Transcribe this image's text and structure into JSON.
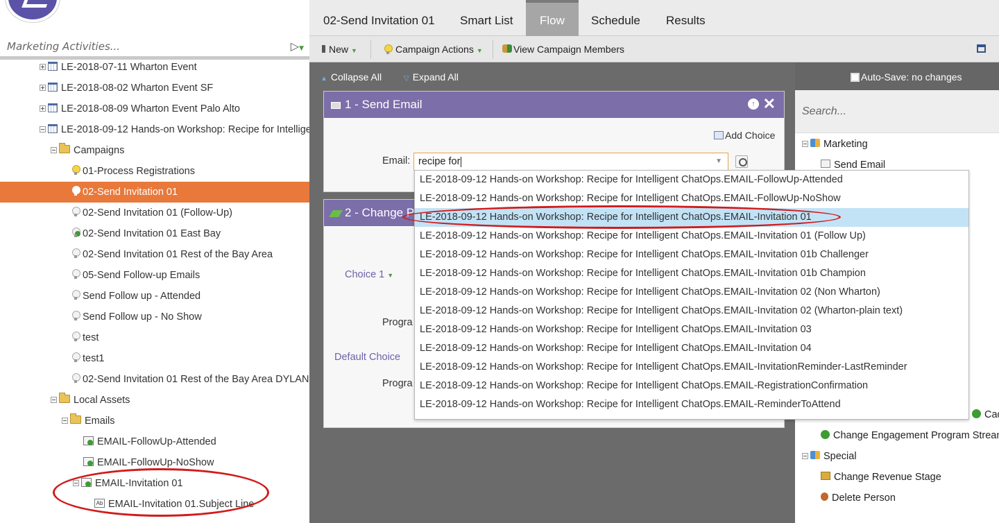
{
  "left_panel": {
    "search_placeholder": "Marketing Activities...",
    "tree": [
      {
        "label": "LE-2018-07-11 Wharton Event",
        "icon": "calendar-icon",
        "indent": 1,
        "toggle": "plus"
      },
      {
        "label": "LE-2018-08-02 Wharton Event SF",
        "icon": "calendar-icon",
        "indent": 1,
        "toggle": "plus"
      },
      {
        "label": "LE-2018-08-09 Wharton Event Palo Alto",
        "icon": "calendar-icon",
        "indent": 1,
        "toggle": "plus"
      },
      {
        "label": "LE-2018-09-12 Hands-on Workshop: Recipe for Intellige",
        "icon": "calendar-icon",
        "indent": 1,
        "toggle": "minus"
      },
      {
        "label": "Campaigns",
        "icon": "folder-icon",
        "indent": 2,
        "toggle": "minus"
      },
      {
        "label": "01-Process Registrations",
        "icon": "bulb-on-icon",
        "indent": 3
      },
      {
        "label": "02-Send Invitation 01",
        "icon": "bulb-icon",
        "indent": 3,
        "selected": true
      },
      {
        "label": "02-Send Invitation 01 (Follow-Up)",
        "icon": "bulb-icon",
        "indent": 3
      },
      {
        "label": "02-Send Invitation 01 East Bay",
        "icon": "bulb-check-icon",
        "indent": 3
      },
      {
        "label": "02-Send Invitation 01 Rest of the Bay Area",
        "icon": "bulb-icon",
        "indent": 3
      },
      {
        "label": "05-Send Follow-up Emails",
        "icon": "bulb-icon",
        "indent": 3
      },
      {
        "label": "Send Follow up - Attended",
        "icon": "bulb-icon",
        "indent": 3
      },
      {
        "label": "Send Follow up - No Show",
        "icon": "bulb-icon",
        "indent": 3
      },
      {
        "label": "test",
        "icon": "bulb-icon",
        "indent": 3
      },
      {
        "label": "test1",
        "icon": "bulb-icon",
        "indent": 3
      },
      {
        "label": "02-Send Invitation 01 Rest of the Bay Area DYLAN",
        "icon": "bulb-icon",
        "indent": 3
      },
      {
        "label": "Local Assets",
        "icon": "folder-icon",
        "indent": 2,
        "toggle": "minus"
      },
      {
        "label": "Emails",
        "icon": "folder-icon",
        "indent": 3,
        "toggle": "minus"
      },
      {
        "label": "EMAIL-FollowUp-Attended",
        "icon": "email-approved-icon",
        "indent": 4
      },
      {
        "label": "EMAIL-FollowUp-NoShow",
        "icon": "email-approved-icon",
        "indent": 4
      },
      {
        "label": "EMAIL-Invitation 01",
        "icon": "email-approved-icon",
        "indent": 4,
        "toggle": "minus"
      },
      {
        "label": "EMAIL-Invitation 01.Subject Line",
        "icon": "subject-line-icon",
        "indent": 5
      }
    ]
  },
  "tabs": [
    "02-Send Invitation 01",
    "Smart List",
    "Flow",
    "Schedule",
    "Results"
  ],
  "active_tab": "Flow",
  "toolbar": {
    "new_label": "New",
    "campaign_actions_label": "Campaign Actions",
    "view_members_label": "View Campaign Members"
  },
  "canvas_bar": {
    "collapse_all": "Collapse All",
    "expand_all": "Expand All",
    "autosave": "Auto-Save: no changes"
  },
  "step1": {
    "title": "1 - Send Email",
    "add_choice": "Add Choice",
    "email_label": "Email:",
    "email_value": "recipe for"
  },
  "step2": {
    "title": "2 - Change P",
    "choice1": "Choice 1",
    "program_label": "Progra",
    "default_choice": "Default Choice",
    "program_label2": "Progra"
  },
  "dropdown": {
    "highlighted_index": 2,
    "items": [
      "LE-2018-09-12 Hands-on Workshop: Recipe for Intelligent ChatOps.EMAIL-FollowUp-Attended",
      "LE-2018-09-12 Hands-on Workshop: Recipe for Intelligent ChatOps.EMAIL-FollowUp-NoShow",
      "LE-2018-09-12 Hands-on Workshop: Recipe for Intelligent ChatOps.EMAIL-Invitation 01",
      "LE-2018-09-12 Hands-on Workshop: Recipe for Intelligent ChatOps.EMAIL-Invitation 01 (Follow Up)",
      "LE-2018-09-12 Hands-on Workshop: Recipe for Intelligent ChatOps.EMAIL-Invitation 01b Challenger",
      "LE-2018-09-12 Hands-on Workshop: Recipe for Intelligent ChatOps.EMAIL-Invitation 01b Champion",
      "LE-2018-09-12 Hands-on Workshop: Recipe for Intelligent ChatOps.EMAIL-Invitation 02 (Non Wharton)",
      "LE-2018-09-12 Hands-on Workshop: Recipe for Intelligent ChatOps.EMAIL-Invitation 02 (Wharton-plain text)",
      "LE-2018-09-12 Hands-on Workshop: Recipe for Intelligent ChatOps.EMAIL-Invitation 03",
      "LE-2018-09-12 Hands-on Workshop: Recipe for Intelligent ChatOps.EMAIL-Invitation 04",
      "LE-2018-09-12 Hands-on Workshop: Recipe for Intelligent ChatOps.EMAIL-InvitationReminder-LastReminder",
      "LE-2018-09-12 Hands-on Workshop: Recipe for Intelligent ChatOps.EMAIL-RegistrationConfirmation",
      "LE-2018-09-12 Hands-on Workshop: Recipe for Intelligent ChatOps.EMAIL-ReminderToAttend"
    ]
  },
  "sidebar": {
    "search_placeholder": "Search...",
    "items": [
      {
        "label": "Marketing",
        "icon": "marketing-group-icon",
        "toggle": "minus",
        "indent": 0
      },
      {
        "label": "Send Email",
        "icon": "mail-icon",
        "indent": 1
      },
      {
        "label": "Cader",
        "icon": "engagement-icon",
        "indent": 1
      },
      {
        "label": "Change Engagement Program Strean",
        "icon": "engagement-icon",
        "indent": 1
      },
      {
        "label": "Special",
        "icon": "special-group-icon",
        "toggle": "minus",
        "indent": 0
      },
      {
        "label": "Change Revenue Stage",
        "icon": "revenue-box-icon",
        "indent": 1
      },
      {
        "label": "Delete Person",
        "icon": "delete-person-icon",
        "indent": 1
      }
    ]
  },
  "colors": {
    "selected_row": "#e8793b",
    "card_header": "#7b6ea9",
    "highlight": "#c2e2f6",
    "annotation_oval": "#d11b1b"
  }
}
